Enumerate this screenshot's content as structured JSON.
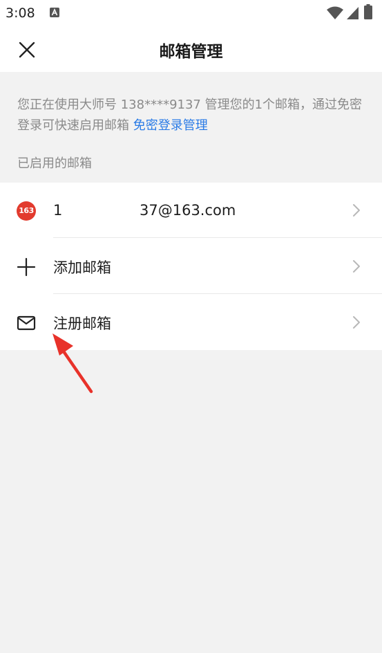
{
  "status_bar": {
    "time": "3:08",
    "icons": [
      "a-notification-icon",
      "wifi-icon",
      "signal-icon",
      "battery-icon"
    ]
  },
  "header": {
    "title": "邮箱管理",
    "close_icon": "close-icon"
  },
  "info": {
    "text": "您正在使用大师号 138****9137 管理您的1个邮箱，通过免密登录可快速启用邮箱 ",
    "link_label": "免密登录管理"
  },
  "section": {
    "label": "已启用的邮箱"
  },
  "list": {
    "account": {
      "badge": "163",
      "email_prefix": "1",
      "email_suffix": "37@163.com"
    },
    "add_label": "添加邮箱",
    "register_label": "注册邮箱"
  },
  "colors": {
    "link": "#2a7be6",
    "badge": "#e23b2e",
    "annotation_arrow": "#e8322a"
  }
}
